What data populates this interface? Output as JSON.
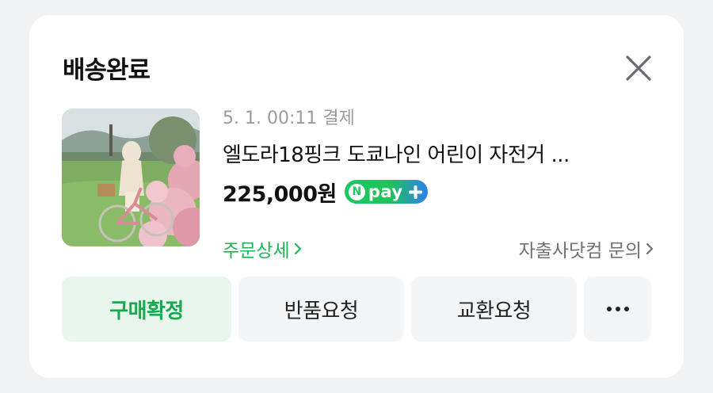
{
  "status_title": "배송완료",
  "order": {
    "paid_time": "5. 1. 00:11 결제",
    "product_name": "엘도라18핑크 도쿄나인 어린이 자전거 ...",
    "price": "225,000원",
    "npay_label": "pay"
  },
  "links": {
    "order_detail": "주문상세",
    "seller_inquiry": "자출사닷컴 문의"
  },
  "actions": {
    "confirm_purchase": "구매확정",
    "return_request": "반품요청",
    "exchange_request": "교환요청"
  },
  "colors": {
    "accent_green": "#1db655",
    "confirm_bg": "#e8f6ed",
    "button_bg": "#f4f5f7"
  },
  "icons": {
    "close": "close-icon",
    "more": "more-dots-icon",
    "chevron": "chevron-right-icon"
  }
}
